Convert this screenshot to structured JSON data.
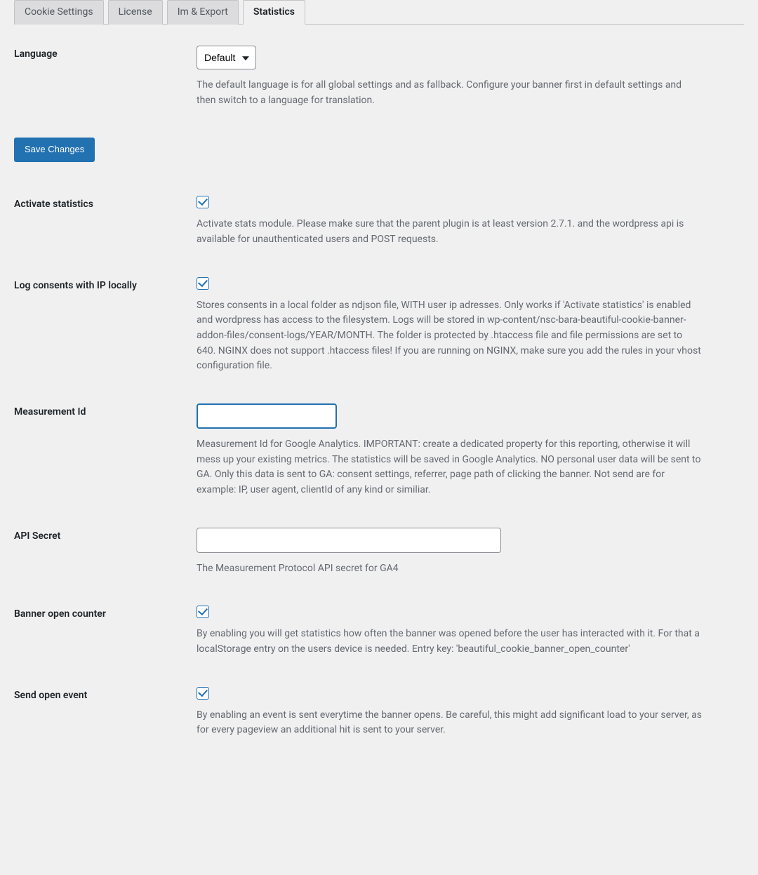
{
  "tabs": [
    {
      "label": "Cookie Settings"
    },
    {
      "label": "License"
    },
    {
      "label": "Im & Export"
    },
    {
      "label": "Statistics"
    }
  ],
  "language": {
    "label": "Language",
    "selected": "Default",
    "description": "The default language is for all global settings and as fallback. Configure your banner first in default settings and then switch to a language for translation."
  },
  "save_button": "Save Changes",
  "fields": {
    "activate_statistics": {
      "label": "Activate statistics",
      "checked": true,
      "description": "Activate stats module. Please make sure that the parent plugin is at least version 2.7.1. and the wordpress api is available for unauthenticated users and POST requests."
    },
    "log_consents": {
      "label": "Log consents with IP locally",
      "checked": true,
      "description": "Stores consents in a local folder as ndjson file, WITH user ip adresses. Only works if 'Activate statistics' is enabled and wordpress has access to the filesystem. Logs will be stored in wp-content/nsc-bara-beautiful-cookie-banner-addon-files/consent-logs/YEAR/MONTH. The folder is protected by .htaccess file and file permissions are set to 640. NGINX does not support .htaccess files! If you are running on NGINX, make sure you add the rules in your vhost configuration file."
    },
    "measurement_id": {
      "label": "Measurement Id",
      "value": "",
      "description": "Measurement Id for Google Analytics. IMPORTANT: create a dedicated property for this reporting, otherwise it will mess up your existing metrics. The statistics will be saved in Google Analytics. NO personal user data will be sent to GA. Only this data is sent to GA: consent settings, referrer, page path of clicking the banner. Not send are for example: IP, user agent, clientId of any kind or similiar."
    },
    "api_secret": {
      "label": "API Secret",
      "value": "",
      "description": "The Measurement Protocol API secret for GA4"
    },
    "banner_open_counter": {
      "label": "Banner open counter",
      "checked": true,
      "description": "By enabling you will get statistics how often the banner was opened before the user has interacted with it. For that a localStorage entry on the users device is needed. Entry key: 'beautiful_cookie_banner_open_counter'"
    },
    "send_open_event": {
      "label": "Send open event",
      "checked": true,
      "description": "By enabling an event is sent everytime the banner opens. Be careful, this might add significant load to your server, as for every pageview an additional hit is sent to your server."
    }
  }
}
